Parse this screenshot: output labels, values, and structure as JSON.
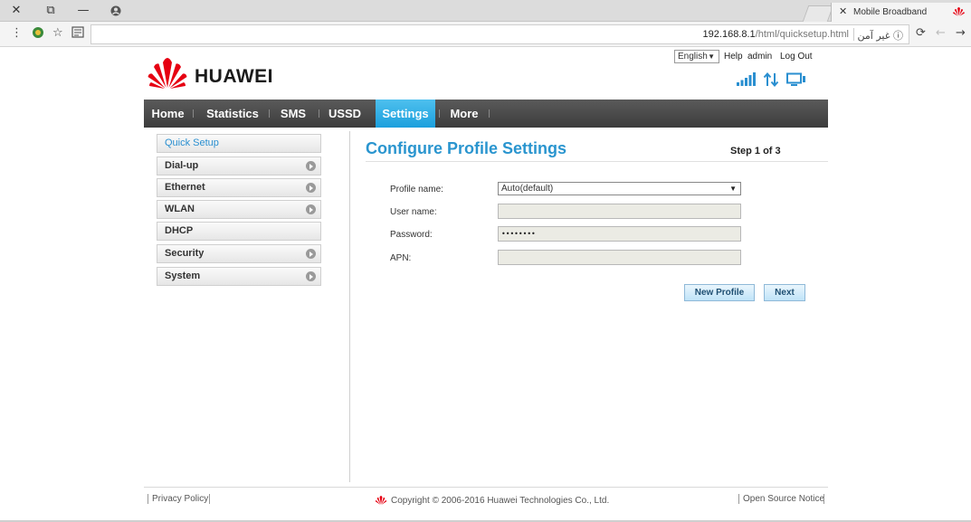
{
  "browser": {
    "tab_title": "Mobile Broadband",
    "url_host": "192.168.8.1",
    "url_path": "/html/quicksetup.html",
    "security_label": "غير آمن",
    "icons": {
      "close": "✕",
      "restore": "⧉",
      "minimize": "—",
      "account": "account-icon",
      "menu": "⋮",
      "extension": "extension-icon",
      "star": "☆",
      "reader": "reader-icon",
      "info": "ⓘ",
      "reload": "⟳",
      "back": "←",
      "forward": "→"
    }
  },
  "header": {
    "language": "English",
    "links": [
      "Help",
      "admin",
      "Log Out"
    ],
    "logo_text": "HUAWEI",
    "brand_color": "#e60012"
  },
  "nav": {
    "items": [
      "Home",
      "Statistics",
      "SMS",
      "USSD",
      "Settings",
      "More"
    ],
    "active": "Settings",
    "active_color": "#1b9fdd"
  },
  "sidebar": {
    "items": [
      {
        "label": "Quick Setup",
        "selected": true,
        "has_arrow": false
      },
      {
        "label": "Dial-up",
        "selected": false,
        "has_arrow": true
      },
      {
        "label": "Ethernet",
        "selected": false,
        "has_arrow": true
      },
      {
        "label": "WLAN",
        "selected": false,
        "has_arrow": true
      },
      {
        "label": "DHCP",
        "selected": false,
        "has_arrow": false
      },
      {
        "label": "Security",
        "selected": false,
        "has_arrow": true
      },
      {
        "label": "System",
        "selected": false,
        "has_arrow": true
      }
    ]
  },
  "main": {
    "title": "Configure Profile Settings",
    "step": "Step 1 of 3",
    "form": {
      "profile_name_label": "Profile name:",
      "profile_name_value": "Auto(default)",
      "user_name_label": "User name:",
      "user_name_value": "",
      "password_label": "Password:",
      "password_value": "••••••••",
      "apn_label": "APN:",
      "apn_value": ""
    },
    "buttons": {
      "new_profile": "New Profile",
      "next": "Next"
    },
    "title_color": "#2a95cf"
  },
  "footer": {
    "privacy": "Privacy Policy",
    "copyright": "Copyright © 2006-2016 Huawei Technologies Co., Ltd.",
    "open_source": "Open Source Notice"
  }
}
